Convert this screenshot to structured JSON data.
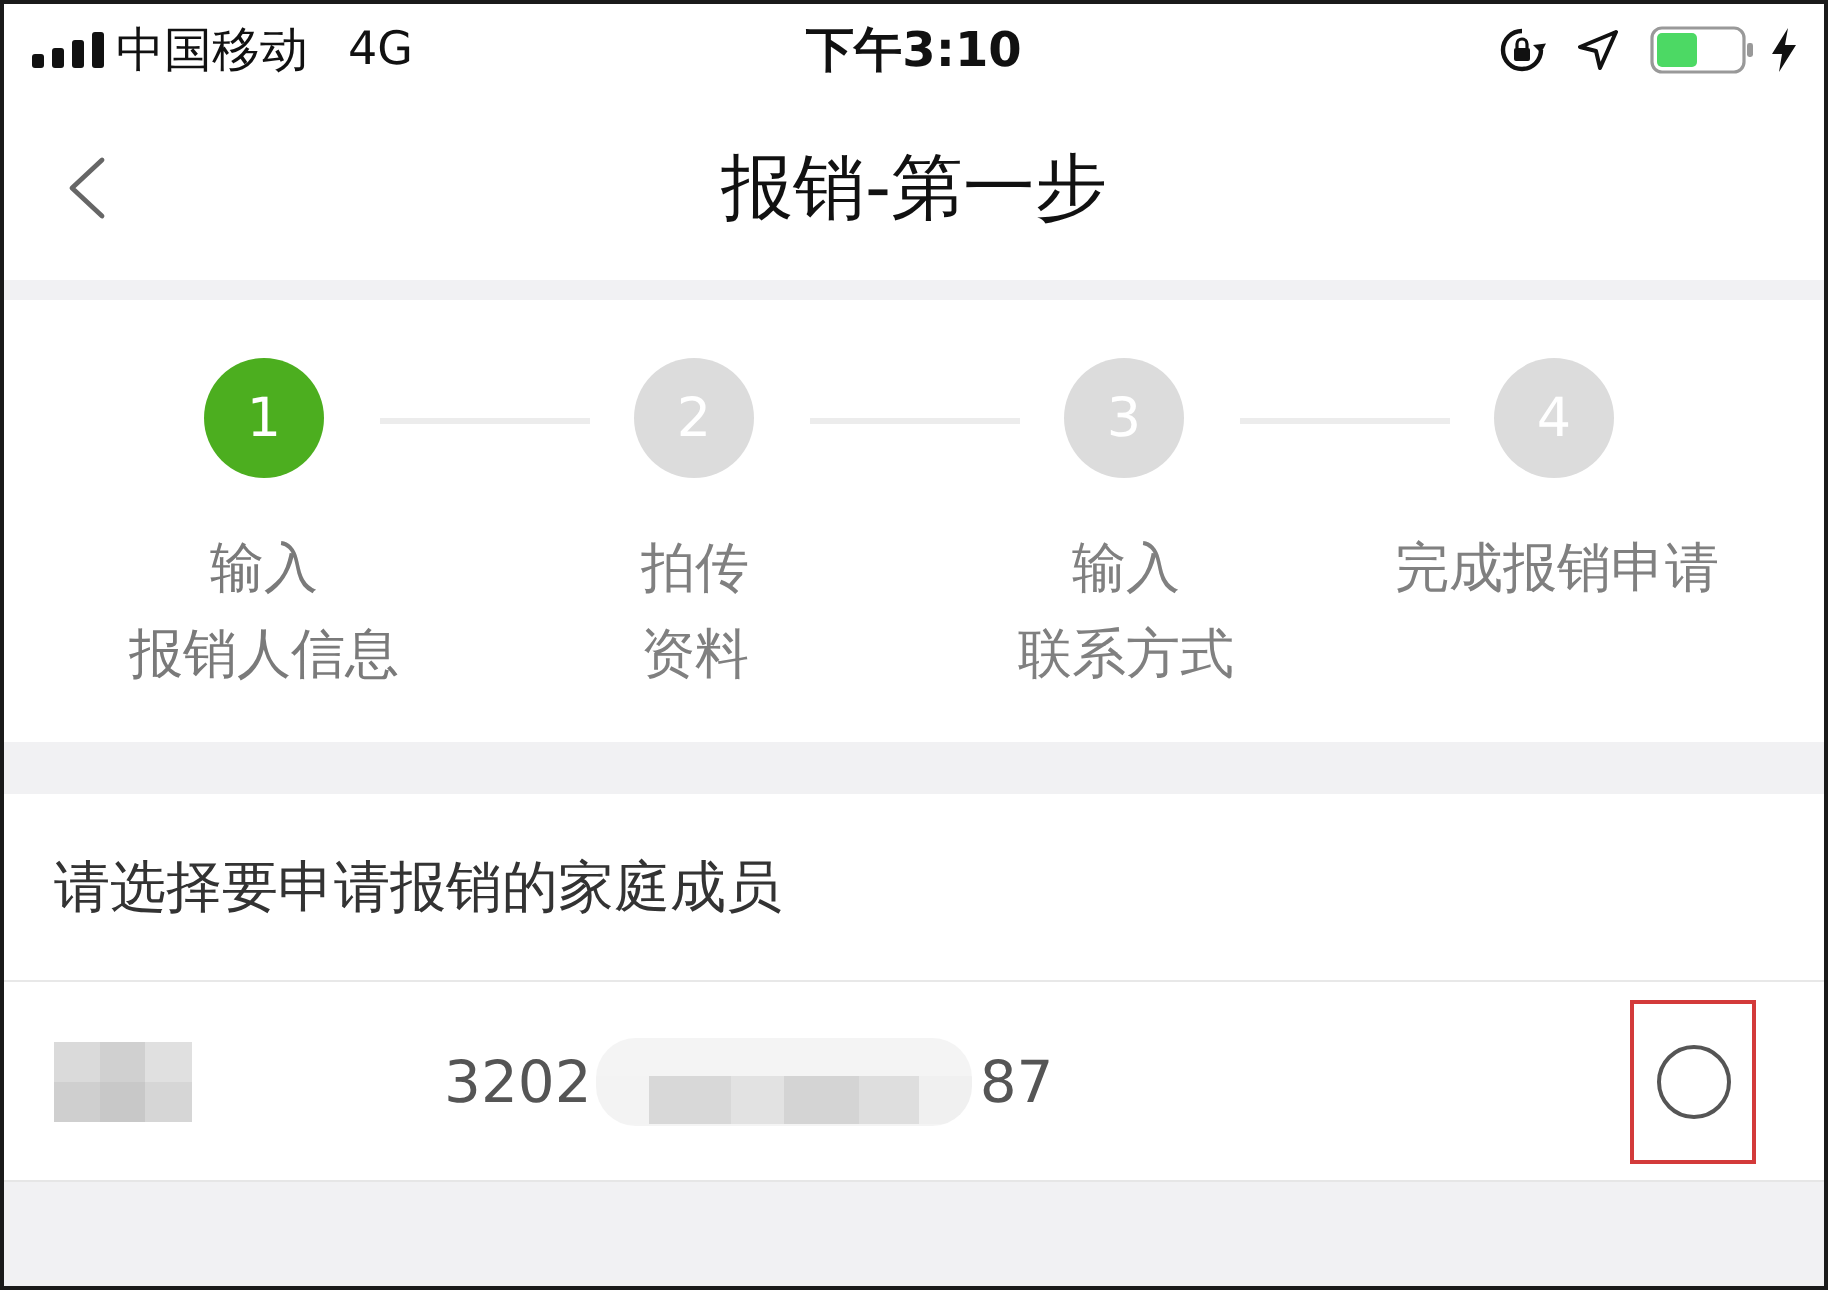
{
  "status_bar": {
    "carrier": "中国移动",
    "network": "4G",
    "time": "下午3:10"
  },
  "nav_bar": {
    "title": "报销-第一步"
  },
  "steps": [
    {
      "number": "1",
      "label_lines": [
        "输入",
        "报销人信息"
      ],
      "active": true
    },
    {
      "number": "2",
      "label_lines": [
        "拍传",
        "资料"
      ],
      "active": false
    },
    {
      "number": "3",
      "label_lines": [
        "输入",
        "联系方式"
      ],
      "active": false
    },
    {
      "number": "4",
      "label_lines": [
        "完成报销申请"
      ],
      "active": false
    }
  ],
  "member_section": {
    "heading": "请选择要申请报销的家庭成员",
    "members": [
      {
        "id_start": "3202",
        "id_end": "87",
        "selected": false,
        "highlighted": true
      }
    ]
  }
}
